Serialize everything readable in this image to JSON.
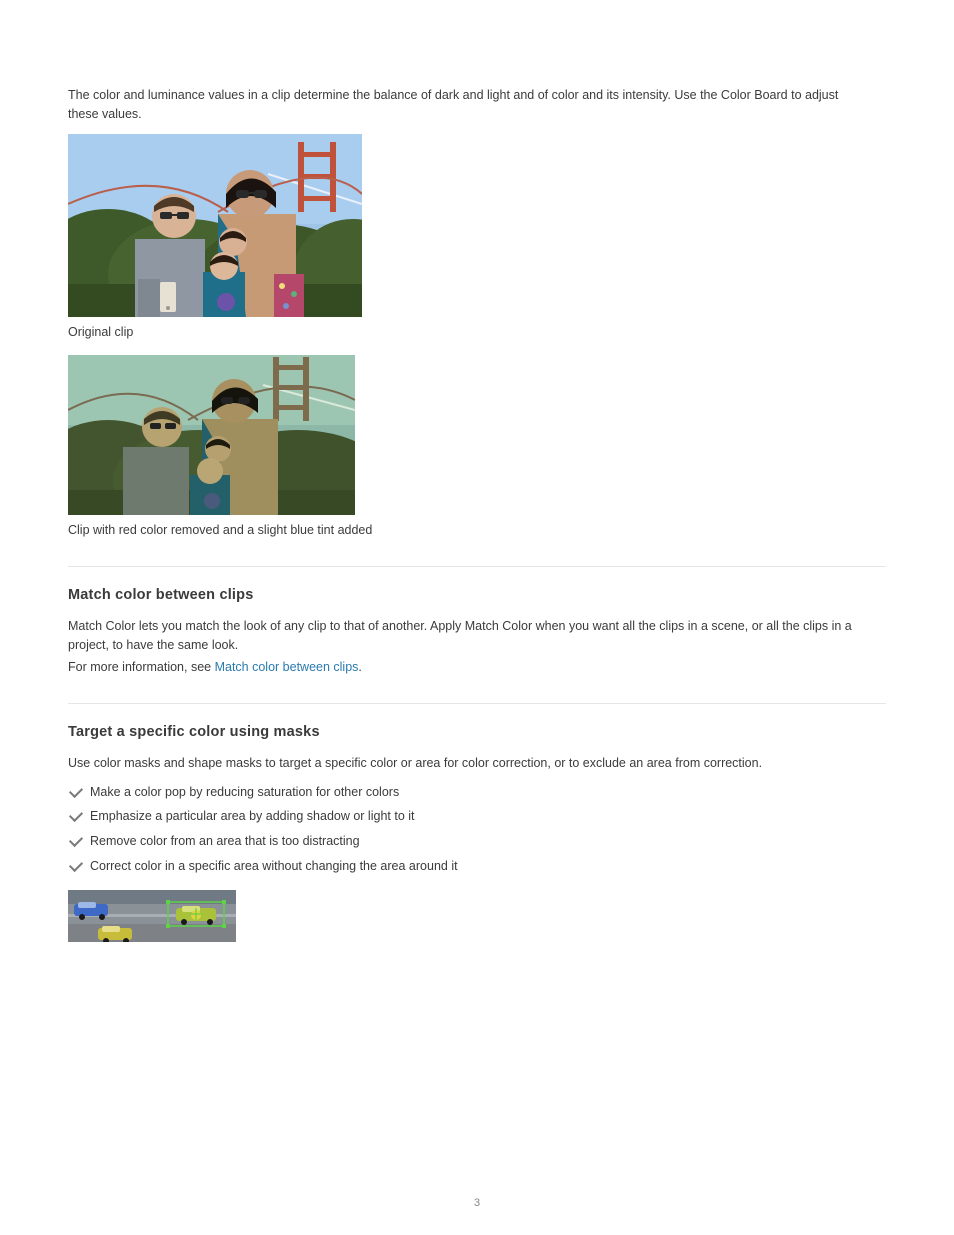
{
  "intro": "The color and luminance values in a clip determine the balance of dark and light and of color and its intensity. Use the Color Board to adjust these values.",
  "figures": {
    "original": {
      "caption_label": "Original clip",
      "alt": "Family selfie in front of the Golden Gate Bridge — original colors"
    },
    "tinted": {
      "caption_label": "Clip with red color removed and a slight blue tint added",
      "alt": "Same photo with reds removed and a blue-green tint applied"
    },
    "tracker": {
      "alt": "Race cars on a track with a green tracking rectangle and crosshair over the lead car"
    }
  },
  "sections": {
    "match": {
      "title": "Match color between clips",
      "intro": "Match Color lets you match the look of any clip to that of another. Apply Match Color when you want all the clips in a scene, or all the clips in a project, to have the same look.",
      "note": "For more information, see ",
      "link_text": "Match color between clips",
      "period": "."
    },
    "target": {
      "title": "Target a specific color using masks",
      "intro": "Use color masks and shape masks to target a specific color or area for color correction, or to exclude an area from correction.",
      "items": [
        "Make a color pop by reducing saturation for other colors",
        "Emphasize a particular area by adding shadow or light to it",
        "Remove color from an area that is too distracting",
        "Correct color in a specific area without changing the area around it"
      ]
    }
  },
  "page_number": "3"
}
